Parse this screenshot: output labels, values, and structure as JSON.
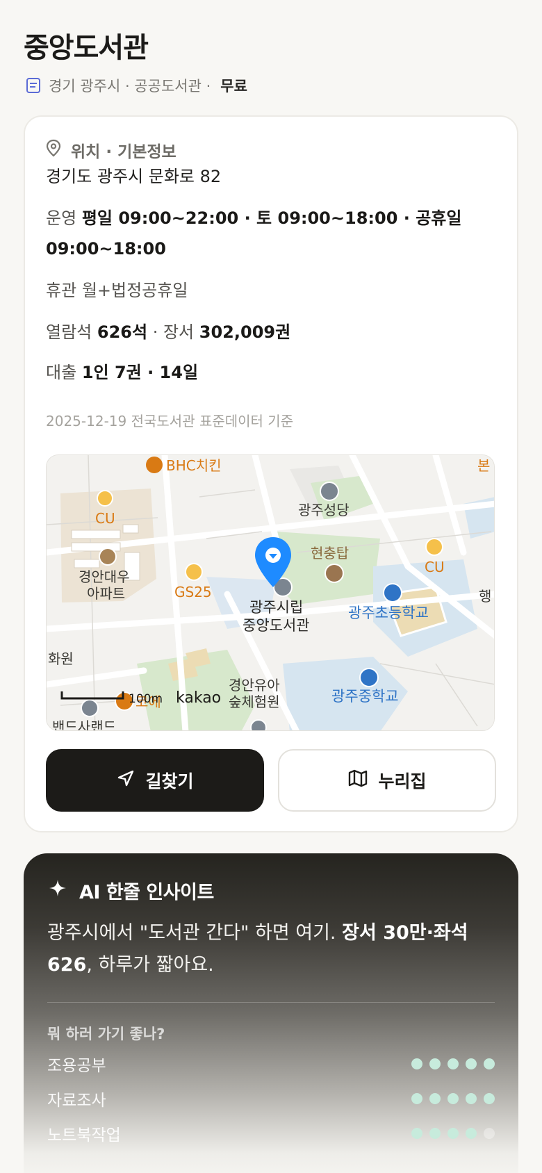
{
  "library": {
    "name": "중앙도서관",
    "meta": "경기 광주시 · 공공도서관 ·",
    "fee": "무료"
  },
  "info_card": {
    "heading": "위치 · 기본정보",
    "address": "경기도 광주시 문화로 82",
    "hours_label": "운영",
    "hours_value_1": "평일 09:00~22:00 · 토 09:00~18:00 · 공휴일",
    "hours_value_2": "09:00~18:00",
    "closed_label": "휴관",
    "closed_value": "월+법정공휴일",
    "seats_label": "열람석",
    "seats_value": "626석",
    "books_label": "· 장서",
    "books_value": "302,009권",
    "loan_label": "대출",
    "loan_value": "1인 7권 · 14일",
    "data_note": "2025-12-19 전국도서관 표준데이터 기준"
  },
  "map": {
    "brand": "kakao",
    "scale": "100m",
    "labels": {
      "bhc": "BHC치킨",
      "cu_left": "CU",
      "gs25": "GS25",
      "apt1": "경안대우",
      "apt2": "아파트",
      "church": "광주성당",
      "monument": "현충탑",
      "cu_right": "CU",
      "bon": "본",
      "haeng": "행",
      "library1": "광주시립",
      "library2": "중앙도서관",
      "elementary": "광주초등학교",
      "middle": "광주중학교",
      "forest1": "경안유아",
      "forest2": "숲체험원",
      "hwawon": "화원",
      "cafe": "코에",
      "bottom_left": "밴드사랜드"
    }
  },
  "actions": {
    "directions": "길찾기",
    "nurijip": "누리집"
  },
  "ai": {
    "title": "AI 한줄 인사이트",
    "text_plain_1": "광주시에서 \"도서관 간다\" 하면 여기.",
    "text_bold_1": "장서 30만·좌석",
    "text_bold_2": "626",
    "text_plain_2": ", 하루가 짧아요.",
    "question": "뭐 하러 가기 좋나?",
    "ratings": [
      {
        "label": "조용공부",
        "score": 5,
        "max": 5
      },
      {
        "label": "자료조사",
        "score": 5,
        "max": 5
      },
      {
        "label": "노트북작업",
        "score": 4,
        "max": 5
      }
    ]
  },
  "colors": {
    "accent_dark": "#1c1b18",
    "dot_on": "#c7ebdc",
    "dot_off": "rgba(255,255,255,0.35)",
    "pin_blue": "#1e8bff",
    "poi_orange": "#d97a14",
    "poi_blue": "#2f74c6"
  }
}
